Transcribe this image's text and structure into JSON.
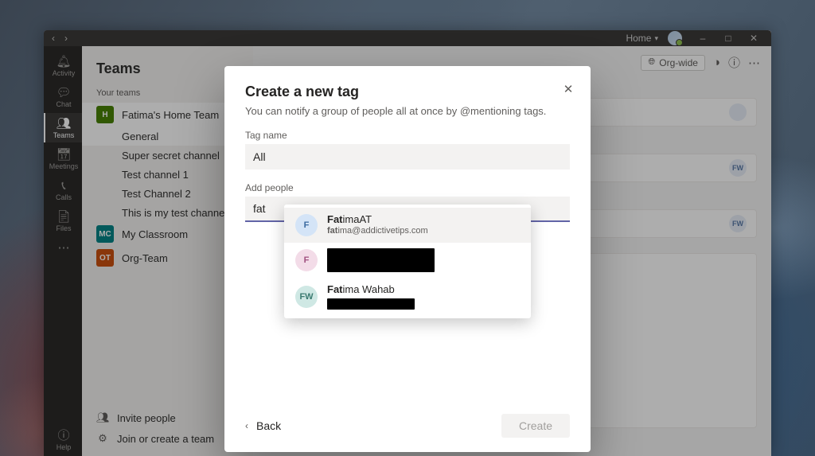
{
  "titlebar": {
    "home_label": "Home"
  },
  "rail": {
    "items": [
      {
        "label": "Activity"
      },
      {
        "label": "Chat"
      },
      {
        "label": "Teams"
      },
      {
        "label": "Meetings"
      },
      {
        "label": "Calls"
      },
      {
        "label": "Files"
      }
    ],
    "help_label": "Help"
  },
  "sidebar": {
    "title": "Teams",
    "section_label": "Your teams",
    "teams": [
      {
        "name": "Fatima's Home Team",
        "initial": "H",
        "channels": [
          "General",
          "Super secret channel",
          "Test channel 1",
          "Test Channel 2",
          "This is my test channel"
        ]
      },
      {
        "name": "My Classroom",
        "initial": "MC"
      },
      {
        "name": "Org-Team",
        "initial": "OT"
      }
    ],
    "invite_label": "Invite people",
    "join_label": "Join or create a team"
  },
  "main": {
    "org_pill": "Org-wide",
    "stub_initials": "FW"
  },
  "modal": {
    "title": "Create a new tag",
    "subtitle": "You can notify a group of people all at once by @mentioning tags.",
    "tag_name_label": "Tag name",
    "tag_name_value": "All",
    "add_people_label": "Add people",
    "add_people_value": "fat",
    "back_label": "Back",
    "create_label": "Create"
  },
  "suggestions": [
    {
      "bold": "Fat",
      "rest": "imaAT",
      "sub_bold": "fat",
      "sub_rest": "ima@addictivetips.com",
      "avatar": "F",
      "avatar_color": "blue",
      "hover": true
    },
    {
      "bold": "",
      "rest": "",
      "sub_bold": "",
      "sub_rest": "",
      "avatar": "F",
      "avatar_color": "pink",
      "redacted": true
    },
    {
      "bold": "Fat",
      "rest": "ima Wahab",
      "sub_bold": "",
      "sub_rest": "",
      "avatar": "FW",
      "avatar_color": "teal",
      "redacted_sub": true
    }
  ]
}
